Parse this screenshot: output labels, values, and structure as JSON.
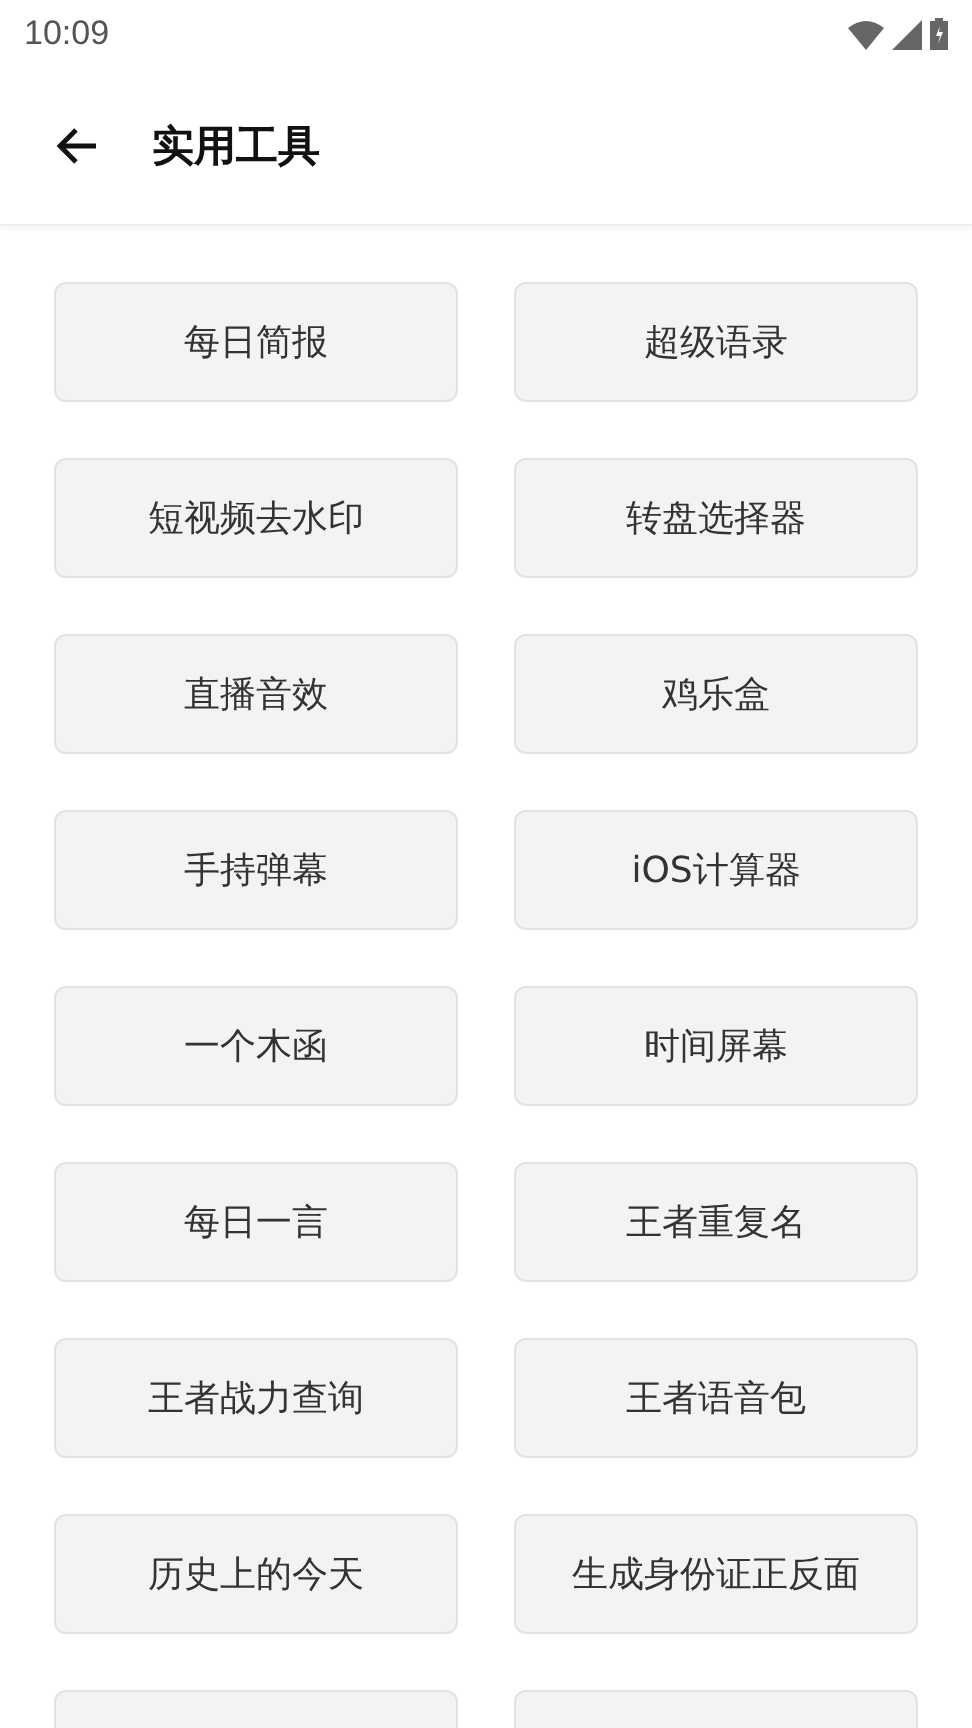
{
  "status_bar": {
    "time": "10:09"
  },
  "header": {
    "title": "实用工具"
  },
  "tools": [
    {
      "kind": "button",
      "label": "每日简报"
    },
    {
      "kind": "button",
      "label": "超级语录"
    },
    {
      "kind": "button",
      "label": "短视频去水印"
    },
    {
      "kind": "button",
      "label": "转盘选择器"
    },
    {
      "kind": "button",
      "label": "直播音效"
    },
    {
      "kind": "button",
      "label": "鸡乐盒"
    },
    {
      "kind": "button",
      "label": "手持弹幕"
    },
    {
      "kind": "button",
      "label": "iOS计算器"
    },
    {
      "kind": "button",
      "label": "一个木函"
    },
    {
      "kind": "button",
      "label": "时间屏幕"
    },
    {
      "kind": "button",
      "label": "每日一言"
    },
    {
      "kind": "button",
      "label": "王者重复名"
    },
    {
      "kind": "button",
      "label": "王者战力查询"
    },
    {
      "kind": "button",
      "label": "王者语音包"
    },
    {
      "kind": "button",
      "label": "历史上的今天"
    },
    {
      "kind": "button",
      "label": "生成身份证正反面"
    },
    {
      "kind": "cut"
    },
    {
      "kind": "cut"
    }
  ]
}
